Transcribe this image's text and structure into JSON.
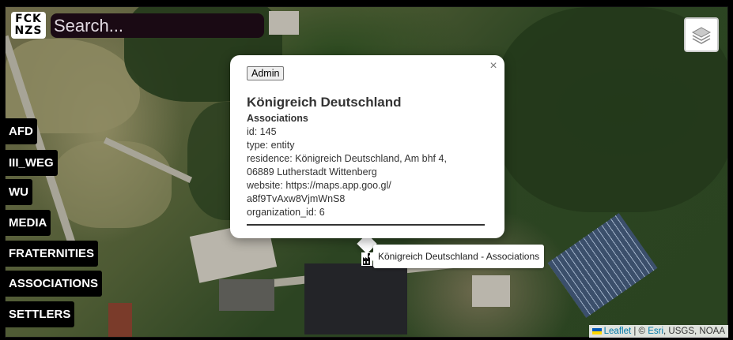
{
  "header": {
    "logo_text": "FCK NZS",
    "search_placeholder": "Search..."
  },
  "layers_control": {
    "icon": "layers-icon"
  },
  "categories": [
    {
      "label": "AFD"
    },
    {
      "label": "III_WEG"
    },
    {
      "label": "WU"
    },
    {
      "label": "MEDIA"
    },
    {
      "label": "FRATERNITIES"
    },
    {
      "label": "ASSOCIATIONS"
    },
    {
      "label": "SETTLERS"
    }
  ],
  "popup": {
    "close_label": "×",
    "admin_label": "Admin",
    "title": "Königreich Deutschland",
    "subtitle": "Associations",
    "lines": [
      "id: 145",
      "type: entity",
      "residence: Königreich Deutschland, Am bhf 4,",
      "06889 Lutherstadt Wittenberg",
      "website: https://maps.app.goo.gl/",
      "a8f9TvAxw8VjmWnS8",
      "organization_id: 6"
    ]
  },
  "marker": {
    "icon": "factory-icon",
    "tooltip": "Königreich Deutschland - Associations"
  },
  "attribution": {
    "leaflet": "Leaflet",
    "separator": " | © ",
    "esri": "Esri",
    "rest": ", USGS, NOAA"
  },
  "colors": {
    "category_bg": "#000000",
    "search_bg": "#1a0a14",
    "link": "#0078a8"
  }
}
